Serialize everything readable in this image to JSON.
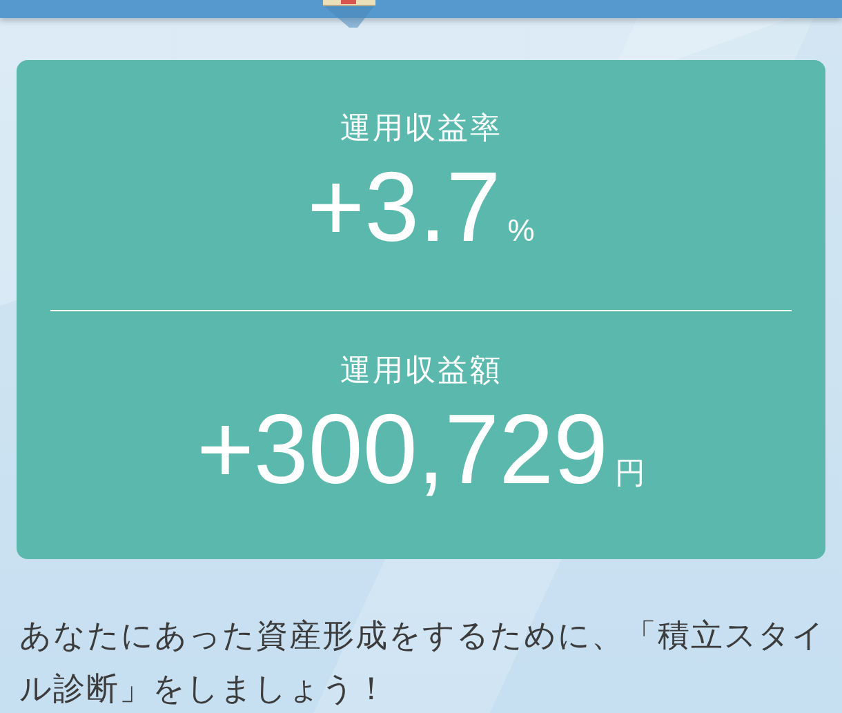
{
  "metrics": [
    {
      "label": "運用収益率",
      "value": "+3.7",
      "unit": "%"
    },
    {
      "label": "運用収益額",
      "value": "+300,729",
      "unit": "円"
    }
  ],
  "message": "あなたにあった資産形成をするために、「積立スタイル診断」をしましょう！"
}
